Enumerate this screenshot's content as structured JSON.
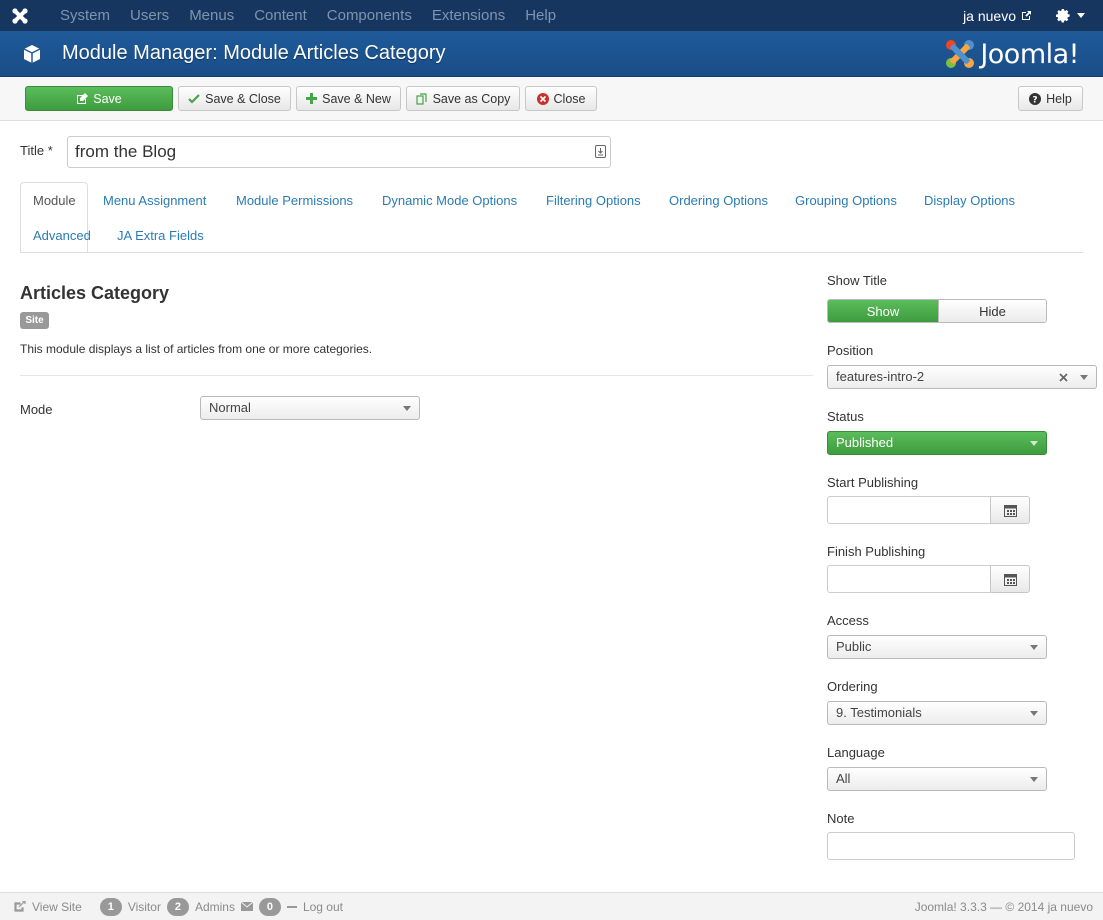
{
  "navbar": {
    "items": [
      "System",
      "Users",
      "Menus",
      "Content",
      "Components",
      "Extensions",
      "Help"
    ],
    "user": "ja nuevo"
  },
  "header": {
    "title": "Module Manager: Module Articles Category",
    "logo_text": "Joomla!"
  },
  "toolbar": {
    "save": "Save",
    "save_close": "Save & Close",
    "save_new": "Save & New",
    "save_copy": "Save as Copy",
    "close": "Close",
    "help": "Help"
  },
  "form": {
    "title_label": "Title *",
    "title_value": "from the Blog"
  },
  "tabs": [
    "Module",
    "Menu Assignment",
    "Module Permissions",
    "Dynamic Mode Options",
    "Filtering Options",
    "Ordering Options",
    "Grouping Options",
    "Display Options",
    "Advanced",
    "JA Extra Fields"
  ],
  "module": {
    "heading": "Articles Category",
    "badge": "Site",
    "description": "This module displays a list of articles from one or more categories.",
    "mode_label": "Mode",
    "mode_value": "Normal"
  },
  "sidebar": {
    "show_title_label": "Show Title",
    "show": "Show",
    "hide": "Hide",
    "position_label": "Position",
    "position_value": "features-intro-2",
    "status_label": "Status",
    "status_value": "Published",
    "start_label": "Start Publishing",
    "finish_label": "Finish Publishing",
    "access_label": "Access",
    "access_value": "Public",
    "ordering_label": "Ordering",
    "ordering_value": "9. Testimonials",
    "language_label": "Language",
    "language_value": "All",
    "note_label": "Note"
  },
  "footer": {
    "view_site": "View Site",
    "visitors_count": "1",
    "visitors_label": "Visitor",
    "admins_count": "2",
    "admins_label": "Admins",
    "messages_count": "0",
    "logout": "Log out",
    "version": "Joomla! 3.3.3 — © 2014 ja nuevo"
  },
  "colors": {
    "navbar": "#17365f",
    "header": "#1e5a9a",
    "success": "#46a546",
    "link": "#2a7bb5"
  }
}
